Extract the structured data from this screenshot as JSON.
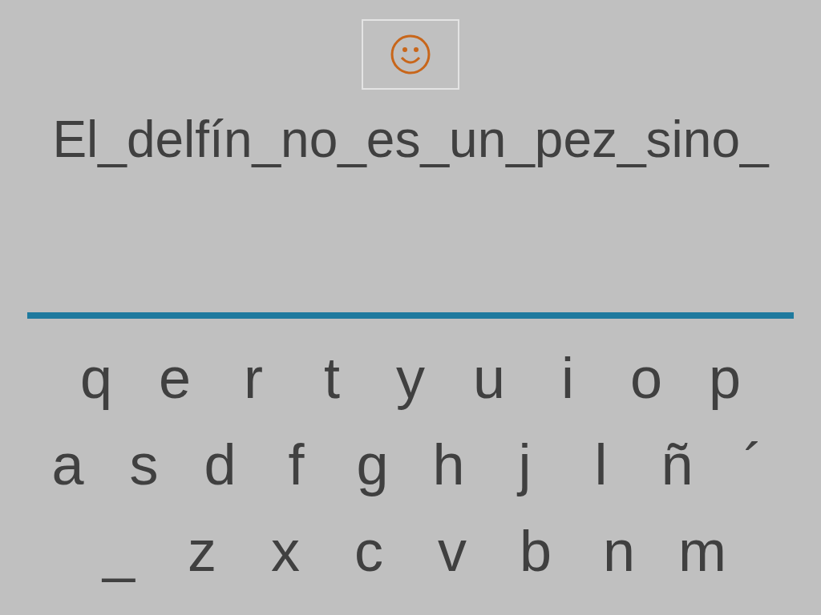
{
  "sentence": "El_delfín_no_es_un_pez_sino_",
  "keyboard": {
    "rows": [
      {
        "keys": [
          "q",
          "e",
          "r",
          "t",
          "y",
          "u",
          "i",
          "o",
          "p"
        ]
      },
      {
        "keys": [
          "a",
          "s",
          "d",
          "f",
          "g",
          "h",
          "j",
          "l",
          "ñ",
          "´"
        ]
      },
      {
        "keys": [
          "_",
          "z",
          "x",
          "c",
          "v",
          "b",
          "n",
          "m"
        ]
      }
    ]
  }
}
